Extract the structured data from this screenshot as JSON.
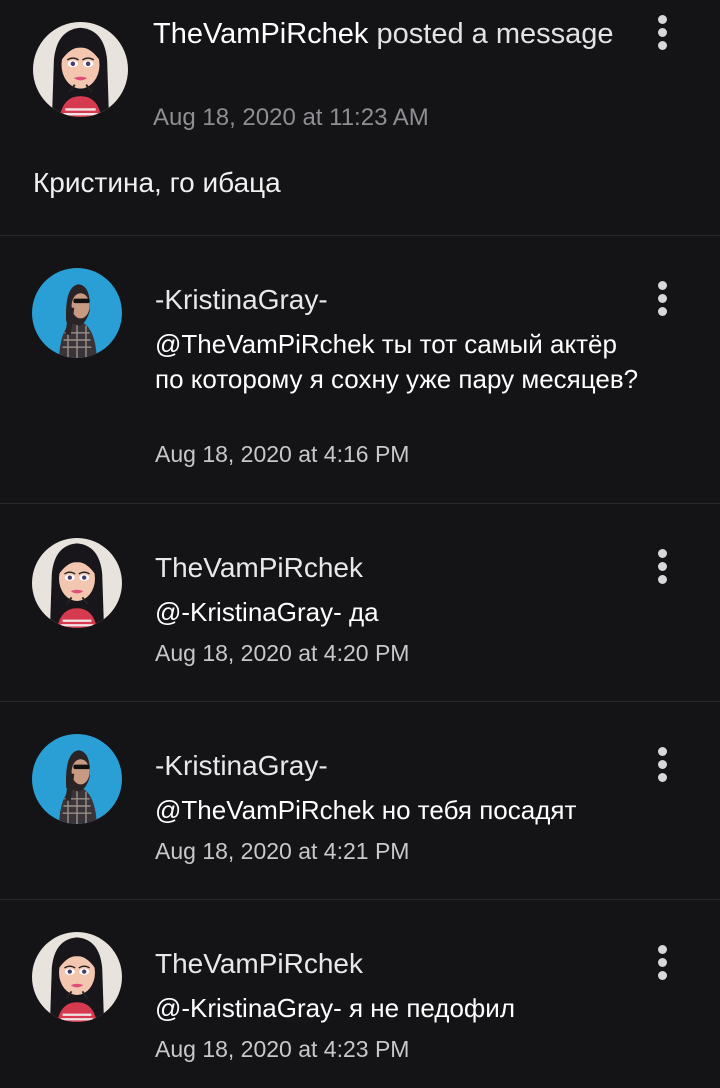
{
  "post": {
    "author": "TheVamPiRchek",
    "verb": "posted a message",
    "time": "Aug 18, 2020 at 11:23 AM",
    "body": "Кристина, го ибаца"
  },
  "comments": [
    {
      "author": "-KristinaGray-",
      "text": "@TheVamPiRchek ты тот самый актёр по которому я сохну уже пару месяцев?",
      "time": "Aug 18, 2020 at 4:16 PM"
    },
    {
      "author": "TheVamPiRchek",
      "text": "@-KristinaGray-  да",
      "time": "Aug 18, 2020 at 4:20 PM"
    },
    {
      "author": "-KristinaGray-",
      "text": "@TheVamPiRchek но тебя посадят",
      "time": "Aug 18, 2020 at 4:21 PM"
    },
    {
      "author": "TheVamPiRchek",
      "text": "@-KristinaGray-  я не педофил",
      "time": "Aug 18, 2020 at 4:23 PM"
    }
  ],
  "icons": {
    "menu": "more-vertical-icon"
  },
  "colors": {
    "background": "#141316",
    "divider": "#2a292d",
    "timestamp": "#8e8e93",
    "kristina_avatar_bg": "#2a9fd6"
  }
}
